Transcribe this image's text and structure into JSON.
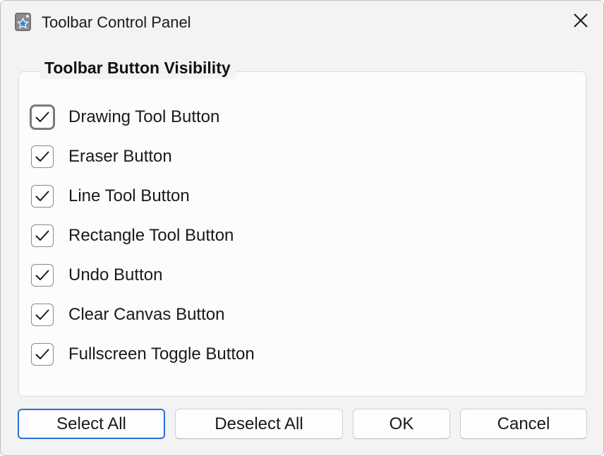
{
  "window": {
    "title": "Toolbar Control Panel",
    "icon": "star-app-icon",
    "close_icon": "close-icon"
  },
  "group": {
    "title": "Toolbar Button Visibility",
    "items": [
      {
        "label": "Drawing Tool Button",
        "checked": true,
        "focused": true
      },
      {
        "label": "Eraser Button",
        "checked": true
      },
      {
        "label": "Line Tool Button",
        "checked": true
      },
      {
        "label": "Rectangle Tool Button",
        "checked": true
      },
      {
        "label": "Undo Button",
        "checked": true
      },
      {
        "label": "Clear Canvas Button",
        "checked": true
      },
      {
        "label": "Fullscreen Toggle Button",
        "checked": true
      }
    ]
  },
  "buttons": {
    "select_all": "Select All",
    "deselect_all": "Deselect All",
    "ok": "OK",
    "cancel": "Cancel"
  },
  "colors": {
    "window_bg": "#f3f3f3",
    "group_bg": "#fcfcfc",
    "default_button_border": "#2a6fd6",
    "checkmark": "#1a1a1a"
  }
}
